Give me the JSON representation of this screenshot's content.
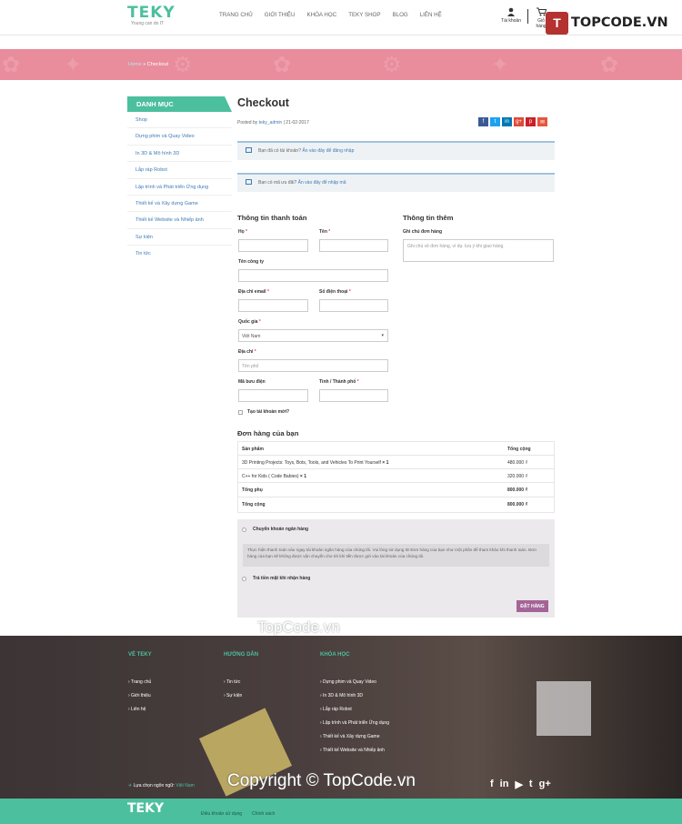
{
  "header": {
    "logo_text": "TEKY",
    "logo_slogan": "Young can do IT",
    "nav": [
      "TRANG CHỦ",
      "GIỚI THIỆU",
      "KHÓA HỌC",
      "TEKY SHOP",
      "BLOG",
      "LIÊN HỆ"
    ],
    "account_label": "Tài khoản",
    "cart_label": "Giỏ hàng",
    "brand_text": "TOPCODE.VN",
    "brand_mark": "T"
  },
  "breadcrumb": {
    "home": "Home",
    "sep": " » ",
    "current": "Checkout"
  },
  "sidebar": {
    "title": "DANH MỤC",
    "items": [
      "Shop",
      "Dựng phim và Quay Video",
      "In 3D & Mô hình 3D",
      "Lắp ráp Robot",
      "Lập trình và Phát triển Ứng dụng",
      "Thiết kế và Xây dựng Game",
      "Thiết kế Website và Nhiếp ảnh",
      "Sự kiện",
      "Tin tức"
    ]
  },
  "page": {
    "title": "Checkout",
    "posted_by": "Posted by",
    "author": "teky_admin",
    "date": " | 21-02-2017",
    "share": [
      "f",
      "t",
      "in",
      "g+",
      "p",
      "✉"
    ],
    "share_colors": [
      "#3b5998",
      "#1da1f2",
      "#0077b5",
      "#dd4b39",
      "#cb2027",
      "#e4573d"
    ]
  },
  "notices": [
    {
      "text": "Bạn đã có tài khoản? ",
      "link": "Ấn vào đây để đăng nhập"
    },
    {
      "text": "Bạn có mã ưu đãi? ",
      "link": "Ấn vào đây để nhập mã"
    }
  ],
  "billing": {
    "title": "Thông tin thanh toán",
    "last_name": "Họ",
    "first_name": "Tên",
    "company": "Tên công ty",
    "email": "Địa chỉ email",
    "phone": "Số điện thoại",
    "country": "Quốc gia",
    "country_value": "Việt Nam",
    "address": "Địa chỉ",
    "address_placeholder": "Tên phố",
    "postcode": "Mã bưu điện",
    "city": "Tỉnh / Thành phố",
    "create_account": "Tạo tài khoản mới?",
    "required_mark": "*"
  },
  "additional": {
    "title": "Thông tin thêm",
    "notes_label": "Ghi chú đơn hàng",
    "notes_placeholder": "Ghi chú về đơn hàng, ví dụ: lưu ý khi giao hàng."
  },
  "order": {
    "title": "Đơn hàng của bạn",
    "col_product": "Sản phẩm",
    "col_total": "Tổng cộng",
    "items": [
      {
        "name": "3D Printing Projects: Toys, Bots, Tools, and Vehicles To Print Yourself",
        "qty": " × 1",
        "total": "480.000 ₫"
      },
      {
        "name": "C++ for Kids ( Code Babies)",
        "qty": " × 1",
        "total": "320.000 ₫"
      }
    ],
    "subtotal_label": "Tổng phụ",
    "subtotal": "800.000 ₫",
    "total_label": "Tổng cộng",
    "total": "800.000 ₫"
  },
  "payment": {
    "bank_transfer": "Chuyển khoản ngân hàng",
    "bank_desc": "Thực hiện thanh toán vào ngay tài khoản ngân hàng của chúng tôi. Vui lòng sử dụng ID Đơn hàng của bạn như một phần để tham khảo khi thanh toán. Đơn hàng của bạn sẽ không được vận chuyển cho tới khi tiền được gửi vào tài khoản của chúng tôi.",
    "cod": "Trả tiền mặt khi nhận hàng",
    "place_order": "ĐẶT HÀNG"
  },
  "footer": {
    "col1_title": "VỀ TEKY",
    "col1": [
      "› Trang chủ",
      "› Giới thiệu",
      "› Liên hệ"
    ],
    "col2_title": "HƯỚNG DẪN",
    "col2": [
      "› Tin tức",
      "› Sự kiện"
    ],
    "col3_title": "KHÓA HỌC",
    "col3": [
      "› Dựng phim và Quay Video",
      "› In 3D & Mô hình 3D",
      "› Lắp ráp Robot",
      "› Lập trình và Phát triển Ứng dụng",
      "› Thiết kế và Xây dựng Game",
      "› Thiết kế Website và Nhiếp ảnh"
    ],
    "lang_label": "Lựa chọn ngôn ngữ: ",
    "lang_value": "Việt Nam",
    "social": [
      "f",
      "in",
      "▶",
      "t",
      "g+"
    ],
    "bottom_logo": "TEKY",
    "bottom_links": [
      "Điều khoản sử dụng",
      "Chính sách"
    ]
  },
  "watermarks": {
    "top": "TopCode.vn",
    "copyright": "Copyright © TopCode.vn"
  },
  "colors": {
    "accent": "#4cbf9e",
    "banner": "#e98c9c",
    "link": "#3f7ab5",
    "button": "#a46497"
  }
}
